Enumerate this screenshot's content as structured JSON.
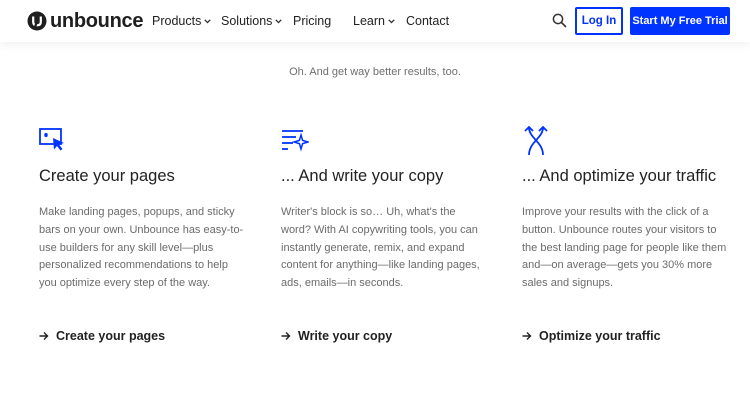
{
  "header": {
    "logo_text": "unbounce",
    "nav": [
      {
        "label": "Products",
        "dropdown": true
      },
      {
        "label": "Solutions",
        "dropdown": true
      },
      {
        "label": "Pricing",
        "dropdown": false
      },
      {
        "label": "Learn",
        "dropdown": true
      },
      {
        "label": "Contact",
        "dropdown": false
      }
    ],
    "login_label": "Log In",
    "trial_label": "Start My Free Trial"
  },
  "tagline": "Oh. And get way better results, too.",
  "features": [
    {
      "icon": "cursor-window-icon",
      "title": "Create your pages",
      "description": "Make landing pages, popups, and sticky bars on your own. Unbounce has easy-to-use builders for any skill level—plus personalized recommendations to help you optimize every step of the way.",
      "link": "Create your pages"
    },
    {
      "icon": "sparkle-lines-icon",
      "title": "... And write your copy",
      "description": "Writer's block is so… Uh, what's the word? With AI copywriting tools, you can instantly generate, remix, and expand content for anything—like landing pages, ads, emails—in seconds.",
      "link": "Write your copy"
    },
    {
      "icon": "split-arrows-icon",
      "title": "... And optimize your traffic",
      "description": "Improve your results with the click of a button. Unbounce routes your visitors to the best landing page for people like them and—on average—gets you 30% more sales and signups.",
      "link": "Optimize your traffic"
    }
  ],
  "colors": {
    "accent": "#0033ff",
    "text": "#222222",
    "muted": "#6b6b6b"
  }
}
